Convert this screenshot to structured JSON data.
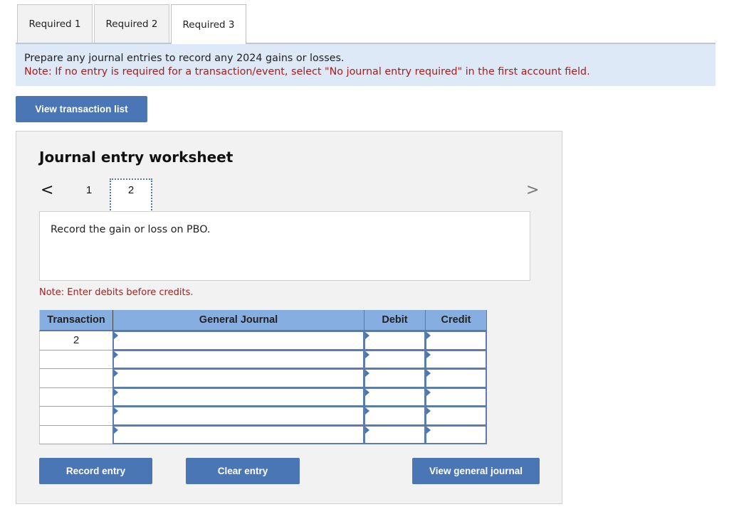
{
  "tabs": [
    {
      "label": "Required 1",
      "active": false
    },
    {
      "label": "Required 2",
      "active": false
    },
    {
      "label": "Required 3",
      "active": true
    }
  ],
  "instructions": {
    "prompt": "Prepare any journal entries to record any 2024 gains or losses.",
    "note": "Note: If no entry is required for a transaction/event, select \"No journal entry required\" in the first account field."
  },
  "buttons": {
    "view_transaction_list": "View transaction list",
    "record_entry": "Record entry",
    "clear_entry": "Clear entry",
    "view_general_journal": "View general journal"
  },
  "worksheet": {
    "title": "Journal entry worksheet",
    "nav": {
      "prev_icon": "chevron-left-icon",
      "next_icon": "chevron-right-icon",
      "prev_glyph": "<",
      "next_glyph": ">",
      "pages": [
        "1",
        "2"
      ],
      "current_page": "2"
    },
    "description": "Record the gain or loss on PBO.",
    "note": "Note: Enter debits before credits."
  },
  "journal_table": {
    "headers": [
      "Transaction",
      "General Journal",
      "Debit",
      "Credit"
    ],
    "rows": [
      {
        "transaction": "2",
        "account": "",
        "debit": "",
        "credit": ""
      },
      {
        "transaction": "",
        "account": "",
        "debit": "",
        "credit": ""
      },
      {
        "transaction": "",
        "account": "",
        "debit": "",
        "credit": ""
      },
      {
        "transaction": "",
        "account": "",
        "debit": "",
        "credit": ""
      },
      {
        "transaction": "",
        "account": "",
        "debit": "",
        "credit": ""
      },
      {
        "transaction": "",
        "account": "",
        "debit": "",
        "credit": ""
      }
    ]
  },
  "colors": {
    "button_blue": "#4a76b5",
    "header_blue": "#87aee0",
    "banner_bg": "#dde9f7",
    "note_red": "#a41e1e",
    "panel_bg": "#f2f2f2"
  }
}
